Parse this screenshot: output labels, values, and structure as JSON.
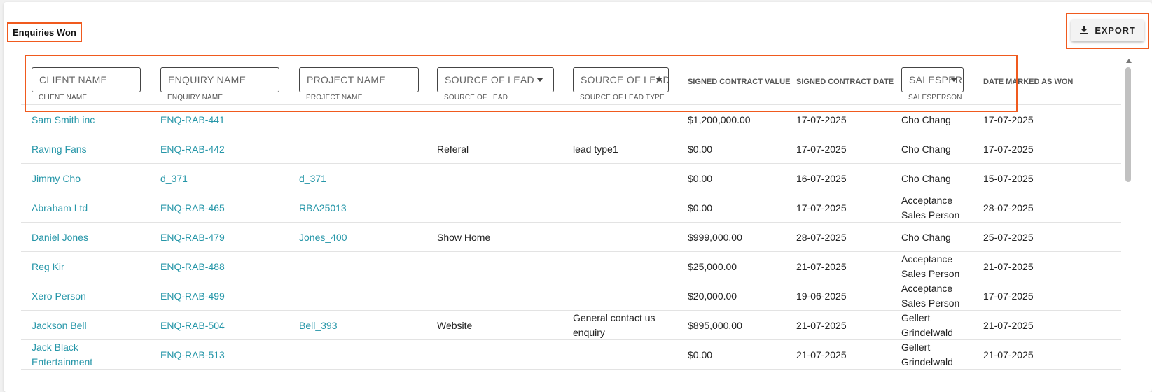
{
  "title": "Enquiries Won",
  "export_label": "EXPORT",
  "filters": {
    "client": {
      "placeholder": "CLIENT NAME",
      "hint": "CLIENT NAME"
    },
    "enquiry": {
      "placeholder": "ENQUIRY NAME",
      "hint": "ENQUIRY NAME"
    },
    "project": {
      "placeholder": "PROJECT NAME",
      "hint": "PROJECT NAME"
    },
    "source": {
      "placeholder": "SOURCE OF LEAD",
      "hint": "SOURCE OF LEAD"
    },
    "source_type": {
      "placeholder": "SOURCE OF LEAD",
      "hint": "SOURCE OF LEAD TYPE"
    },
    "salesperson": {
      "placeholder": "SALESPERSON",
      "hint": "SALESPERSON"
    }
  },
  "headers": {
    "signed_value": "SIGNED CONTRACT VALUE",
    "signed_date": "SIGNED CONTRACT DATE",
    "date_won": "DATE MARKED AS WON"
  },
  "rows": [
    {
      "client": "Sam Smith inc",
      "enquiry": "ENQ-RAB-441",
      "project": "",
      "source": "",
      "source_type": "",
      "value": "$1,200,000.00",
      "signed": "17-07-2025",
      "sales": "Cho Chang",
      "won": "17-07-2025"
    },
    {
      "client": "Raving Fans",
      "enquiry": "ENQ-RAB-442",
      "project": "",
      "source": "Referal",
      "source_type": "lead type1",
      "value": "$0.00",
      "signed": "17-07-2025",
      "sales": "Cho Chang",
      "won": "17-07-2025"
    },
    {
      "client": "Jimmy Cho",
      "enquiry": "d_371",
      "project": "d_371",
      "source": "",
      "source_type": "",
      "value": "$0.00",
      "signed": "16-07-2025",
      "sales": "Cho Chang",
      "won": "15-07-2025"
    },
    {
      "client": "Abraham Ltd",
      "enquiry": "ENQ-RAB-465",
      "project": "RBA25013",
      "source": "",
      "source_type": "",
      "value": "$0.00",
      "signed": "17-07-2025",
      "sales": "Acceptance\nSales Person",
      "won": "28-07-2025"
    },
    {
      "client": "Daniel Jones",
      "enquiry": "ENQ-RAB-479",
      "project": "Jones_400",
      "source": "Show Home",
      "source_type": "",
      "value": "$999,000.00",
      "signed": "28-07-2025",
      "sales": "Cho Chang",
      "won": "25-07-2025"
    },
    {
      "client": "Reg Kir",
      "enquiry": "ENQ-RAB-488",
      "project": "",
      "source": "",
      "source_type": "",
      "value": "$25,000.00",
      "signed": "21-07-2025",
      "sales": "Acceptance\nSales Person",
      "won": "21-07-2025"
    },
    {
      "client": "Xero Person",
      "enquiry": "ENQ-RAB-499",
      "project": "",
      "source": "",
      "source_type": "",
      "value": "$20,000.00",
      "signed": "19-06-2025",
      "sales": "Acceptance\nSales Person",
      "won": "17-07-2025"
    },
    {
      "client": "Jackson Bell",
      "enquiry": "ENQ-RAB-504",
      "project": "Bell_393",
      "source": "Website",
      "source_type": "General contact us\nenquiry",
      "value": "$895,000.00",
      "signed": "21-07-2025",
      "sales": "Gellert\nGrindelwald",
      "won": "21-07-2025"
    },
    {
      "client": "Jack Black\nEntertainment",
      "enquiry": "ENQ-RAB-513",
      "project": "",
      "source": "",
      "source_type": "",
      "value": "$0.00",
      "signed": "21-07-2025",
      "sales": "Gellert\nGrindelwald",
      "won": "21-07-2025"
    }
  ]
}
